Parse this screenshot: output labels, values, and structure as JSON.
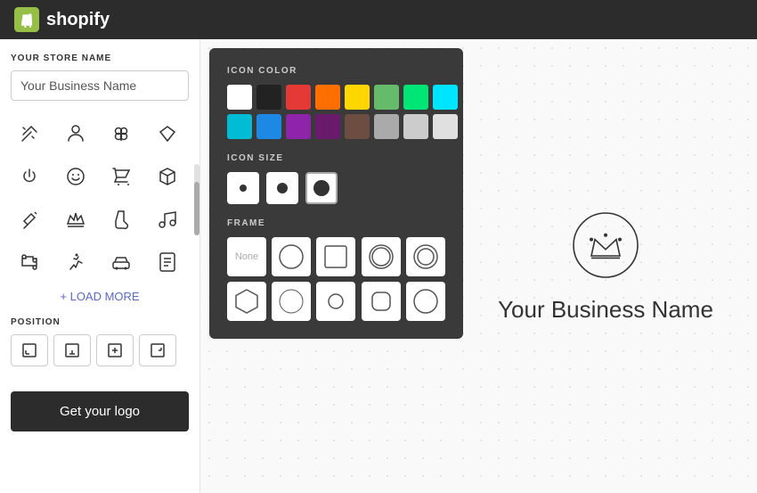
{
  "header": {
    "logo_text": "shopify",
    "logo_icon": "shopify-bag"
  },
  "sidebar": {
    "store_name_label": "YOUR STORE NAME",
    "store_name_placeholder": "Your Business Name",
    "store_name_value": "Your Business Name",
    "load_more_label": "+ LOAD MORE",
    "position_label": "POSITION",
    "get_logo_label": "Get your logo",
    "icons": [
      "magic-wand",
      "person",
      "clover",
      "diamond",
      "power",
      "smile",
      "cart",
      "box",
      "shovel",
      "crown",
      "sock",
      "music",
      "puzzle",
      "runner",
      "car",
      "document"
    ],
    "position_options": [
      "align-bottom-left",
      "align-bottom-center",
      "align-center-center",
      "align-right-center"
    ]
  },
  "popup": {
    "icon_color_label": "ICON COLOR",
    "icon_size_label": "ICON SIZE",
    "frame_label": "FRAME",
    "colors": [
      "#ffffff",
      "#222222",
      "#e53935",
      "#ff6f00",
      "#ffd600",
      "#66bb6a",
      "#00e676",
      "#00e5ff",
      "#00bcd4",
      "#1e88e5",
      "#8e24aa",
      "#6a1a6a",
      "#6d4c41",
      "#aaaaaa",
      "#cccccc",
      "#e0e0e0"
    ],
    "selected_color": "#ffffff",
    "sizes": [
      "small",
      "medium",
      "large"
    ],
    "selected_size": "large",
    "frames": [
      "none",
      "circle",
      "square",
      "circle-outline",
      "circle-outline-2",
      "hexagon",
      "circle-thin",
      "circle-small",
      "square-rounded",
      "circle-outer"
    ]
  },
  "preview": {
    "business_name": "Your Business Name"
  }
}
